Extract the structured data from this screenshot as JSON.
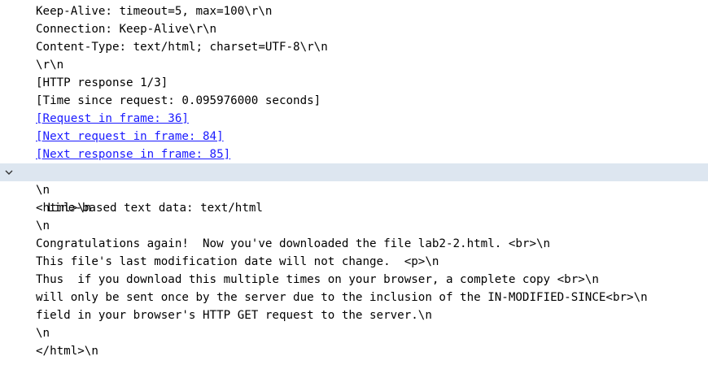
{
  "packet_details": {
    "http_lines": [
      "Keep-Alive: timeout=5, max=100\\r\\n",
      "Connection: Keep-Alive\\r\\n",
      "Content-Type: text/html; charset=UTF-8\\r\\n",
      "\\r\\n",
      "[HTTP response 1/3]",
      "[Time since request: 0.095976000 seconds]"
    ],
    "links": {
      "request_in_frame": "[Request in frame: 36]",
      "next_request_in_frame": "[Next request in frame: 84]",
      "next_response_in_frame": "[Next response in frame: 85]"
    },
    "text_data_header": "Line-based text data: text/html",
    "text_data_lines": [
      "\\n",
      "<html>\\n",
      "\\n",
      "Congratulations again!  Now you've downloaded the file lab2-2.html. <br>\\n",
      "This file's last modification date will not change.  <p>\\n",
      "Thus  if you download this multiple times on your browser, a complete copy <br>\\n",
      "will only be sent once by the server due to the inclusion of the IN-MODIFIED-SINCE<br>\\n",
      "field in your browser's HTTP GET request to the server.\\n",
      "\\n",
      "</html>\\n"
    ],
    "colors": {
      "link": "#1a1aff",
      "selected_row": "#dde6f0"
    },
    "icons": {
      "expand_toggle": "chevron-down-icon"
    }
  }
}
